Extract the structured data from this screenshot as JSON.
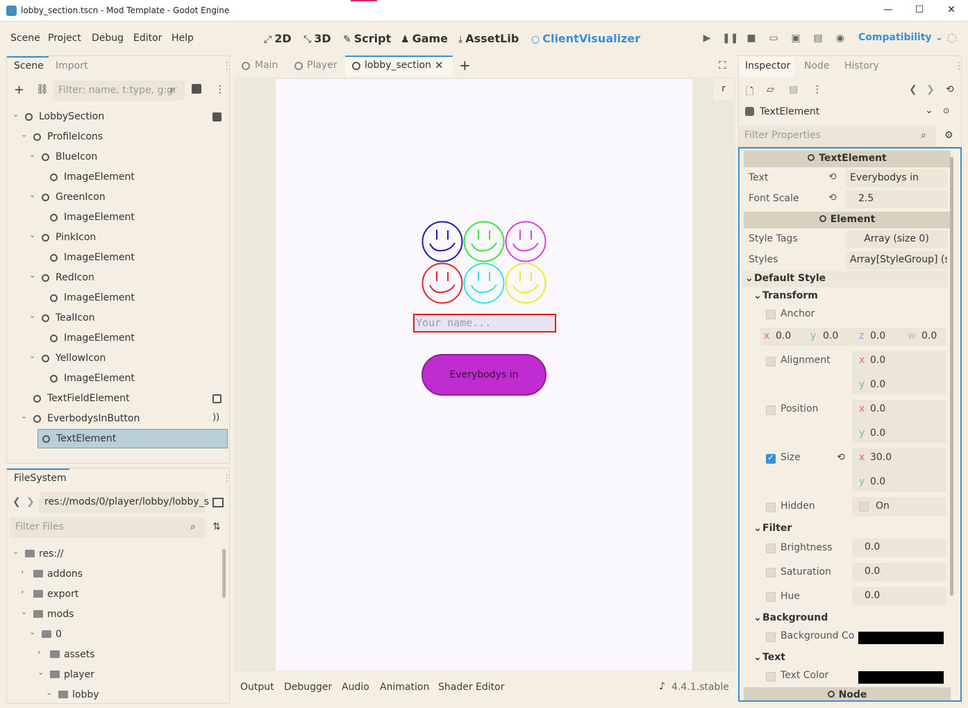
{
  "window": {
    "title": "lobby_section.tscn - Mod Template - Godot Engine"
  },
  "menu": [
    "Scene",
    "Project",
    "Debug",
    "Editor",
    "Help"
  ],
  "workspaces": [
    {
      "icon": "2d-icon",
      "label": "2D"
    },
    {
      "icon": "3d-icon",
      "label": "3D"
    },
    {
      "icon": "script-icon",
      "label": "Script"
    },
    {
      "icon": "game-icon",
      "label": "Game"
    },
    {
      "icon": "assetlib-icon",
      "label": "AssetLib"
    },
    {
      "icon": "client-visualizer-icon",
      "label": "ClientVisualizer"
    }
  ],
  "renderer": "Compatibility",
  "scene_dock": {
    "tabs": [
      "Scene",
      "Import"
    ],
    "filter_placeholder": "Filter: name, t:type, g:gr",
    "tree": [
      {
        "label": "LobbySection",
        "depth": 0
      },
      {
        "label": "ProfileIcons",
        "depth": 1
      },
      {
        "label": "BlueIcon",
        "depth": 2
      },
      {
        "label": "ImageElement",
        "depth": 3
      },
      {
        "label": "GreenIcon",
        "depth": 2
      },
      {
        "label": "ImageElement",
        "depth": 3
      },
      {
        "label": "PinkIcon",
        "depth": 2
      },
      {
        "label": "ImageElement",
        "depth": 3
      },
      {
        "label": "RedIcon",
        "depth": 2
      },
      {
        "label": "ImageElement",
        "depth": 3
      },
      {
        "label": "TealIcon",
        "depth": 2
      },
      {
        "label": "ImageElement",
        "depth": 3
      },
      {
        "label": "YellowIcon",
        "depth": 2
      },
      {
        "label": "ImageElement",
        "depth": 3
      },
      {
        "label": "TextFieldElement",
        "depth": 1
      },
      {
        "label": "EverbodysInButton",
        "depth": 1
      },
      {
        "label": "TextElement",
        "depth": 2,
        "selected": true
      }
    ]
  },
  "filesystem": {
    "title": "FileSystem",
    "path": "res://mods/0/player/lobby/lobby_s",
    "filter_placeholder": "Filter Files",
    "tree": [
      "res://",
      "addons",
      "export",
      "mods",
      "0",
      "assets",
      "player",
      "lobby"
    ]
  },
  "editor_tabs": [
    "Main",
    "Player",
    "lobby_section"
  ],
  "viewport": {
    "corner_label": "r",
    "faces": [
      "#1a1ab8",
      "#39e639",
      "#e03ce0",
      "#e02626",
      "#2ee6e6",
      "#ecec2a"
    ],
    "name_placeholder": "Your name...",
    "button_label": "Everybodys in"
  },
  "bottom_panel": {
    "tabs": [
      "Output",
      "Debugger",
      "Audio",
      "Animation",
      "Shader Editor"
    ],
    "version": "4.4.1.stable"
  },
  "inspector": {
    "tabs": [
      "Inspector",
      "Node",
      "History"
    ],
    "object": "TextElement",
    "filter_placeholder": "Filter Properties",
    "hdr_text_element": "TextElement",
    "text_label": "Text",
    "text_value": "Everybodys in",
    "fontscale_label": "Font Scale",
    "fontscale_value": "2.5",
    "hdr_element": "Element",
    "styletags_label": "Style Tags",
    "styletags_value": "Array (size 0)",
    "styles_label": "Styles",
    "styles_value": "Array[StyleGroup] (s",
    "default_style": "Default Style",
    "transform": "Transform",
    "anchor": "Anchor",
    "anchor_vals": {
      "x": "0.0",
      "y": "0.0",
      "z": "0.0",
      "w": "0.0"
    },
    "alignment": "Alignment",
    "alignment_vals": {
      "x": "0.0",
      "y": "0.0"
    },
    "position": "Position",
    "position_vals": {
      "x": "0.0",
      "y": "0.0"
    },
    "size": "Size",
    "size_vals": {
      "x": "30.0",
      "y": "0.0"
    },
    "hidden": "Hidden",
    "hidden_val": "On",
    "filter": "Filter",
    "brightness": "Brightness",
    "brightness_val": "0.0",
    "saturation": "Saturation",
    "saturation_val": "0.0",
    "hue": "Hue",
    "hue_val": "0.0",
    "background": "Background",
    "bg_color": "Background Co",
    "text_section": "Text",
    "text_color": "Text Color",
    "hdr_node": "Node"
  }
}
